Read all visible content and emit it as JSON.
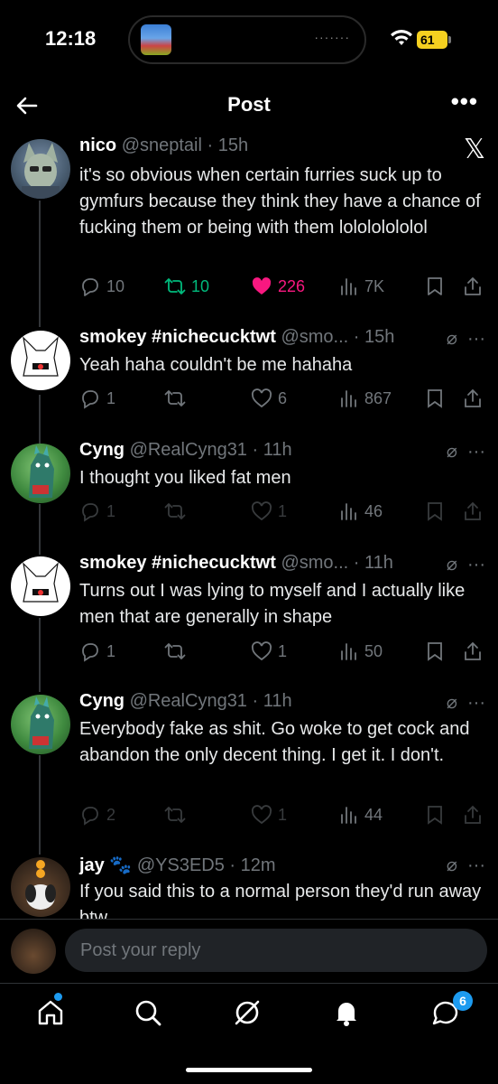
{
  "status_bar": {
    "time": "12:18",
    "island_dots": "·······",
    "battery": "61"
  },
  "header": {
    "title": "Post"
  },
  "posts": [
    {
      "name": "nico",
      "handle": "@sneptail",
      "time": "· 15h",
      "text": "it's so obvious when certain furries suck up to gymfurs because they think they have a chance of fucking them or being with them lolololololol",
      "replies": "10",
      "reposts": "10",
      "likes": "226",
      "views": "7K"
    },
    {
      "name": "smokey #nichecucktwt",
      "handle": "@smo...",
      "time": "· 15h",
      "text": "Yeah haha couldn't be me hahaha",
      "replies": "1",
      "reposts": "",
      "likes": "6",
      "views": "867"
    },
    {
      "name": "Cyng",
      "handle": "@RealCyng31",
      "time": "· 11h",
      "text": "I thought you liked fat men",
      "replies": "1",
      "reposts": "",
      "likes": "1",
      "views": "46"
    },
    {
      "name": "smokey #nichecucktwt",
      "handle": "@smo...",
      "time": "· 11h",
      "text": "Turns out I was lying to myself and I actually like men that are generally in shape",
      "replies": "1",
      "reposts": "",
      "likes": "1",
      "views": "50"
    },
    {
      "name": "Cyng",
      "handle": "@RealCyng31",
      "time": "· 11h",
      "text": "Everybody fake as shit. Go woke to get cock and abandon the only decent thing. I get it. I don't.",
      "replies": "2",
      "reposts": "",
      "likes": "1",
      "views": "44"
    },
    {
      "name": "jay",
      "handle": "@YS3ED5",
      "time": "· 12m",
      "text": "If you said this to a normal person they'd run away btw"
    }
  ],
  "reply": {
    "placeholder": "Post your reply"
  },
  "tabbar": {
    "messages_badge": "6"
  },
  "colors": {
    "accent": "#1d9bf0",
    "repost_active": "#00ba7c",
    "like_active": "#f91880",
    "muted": "#71767b"
  }
}
